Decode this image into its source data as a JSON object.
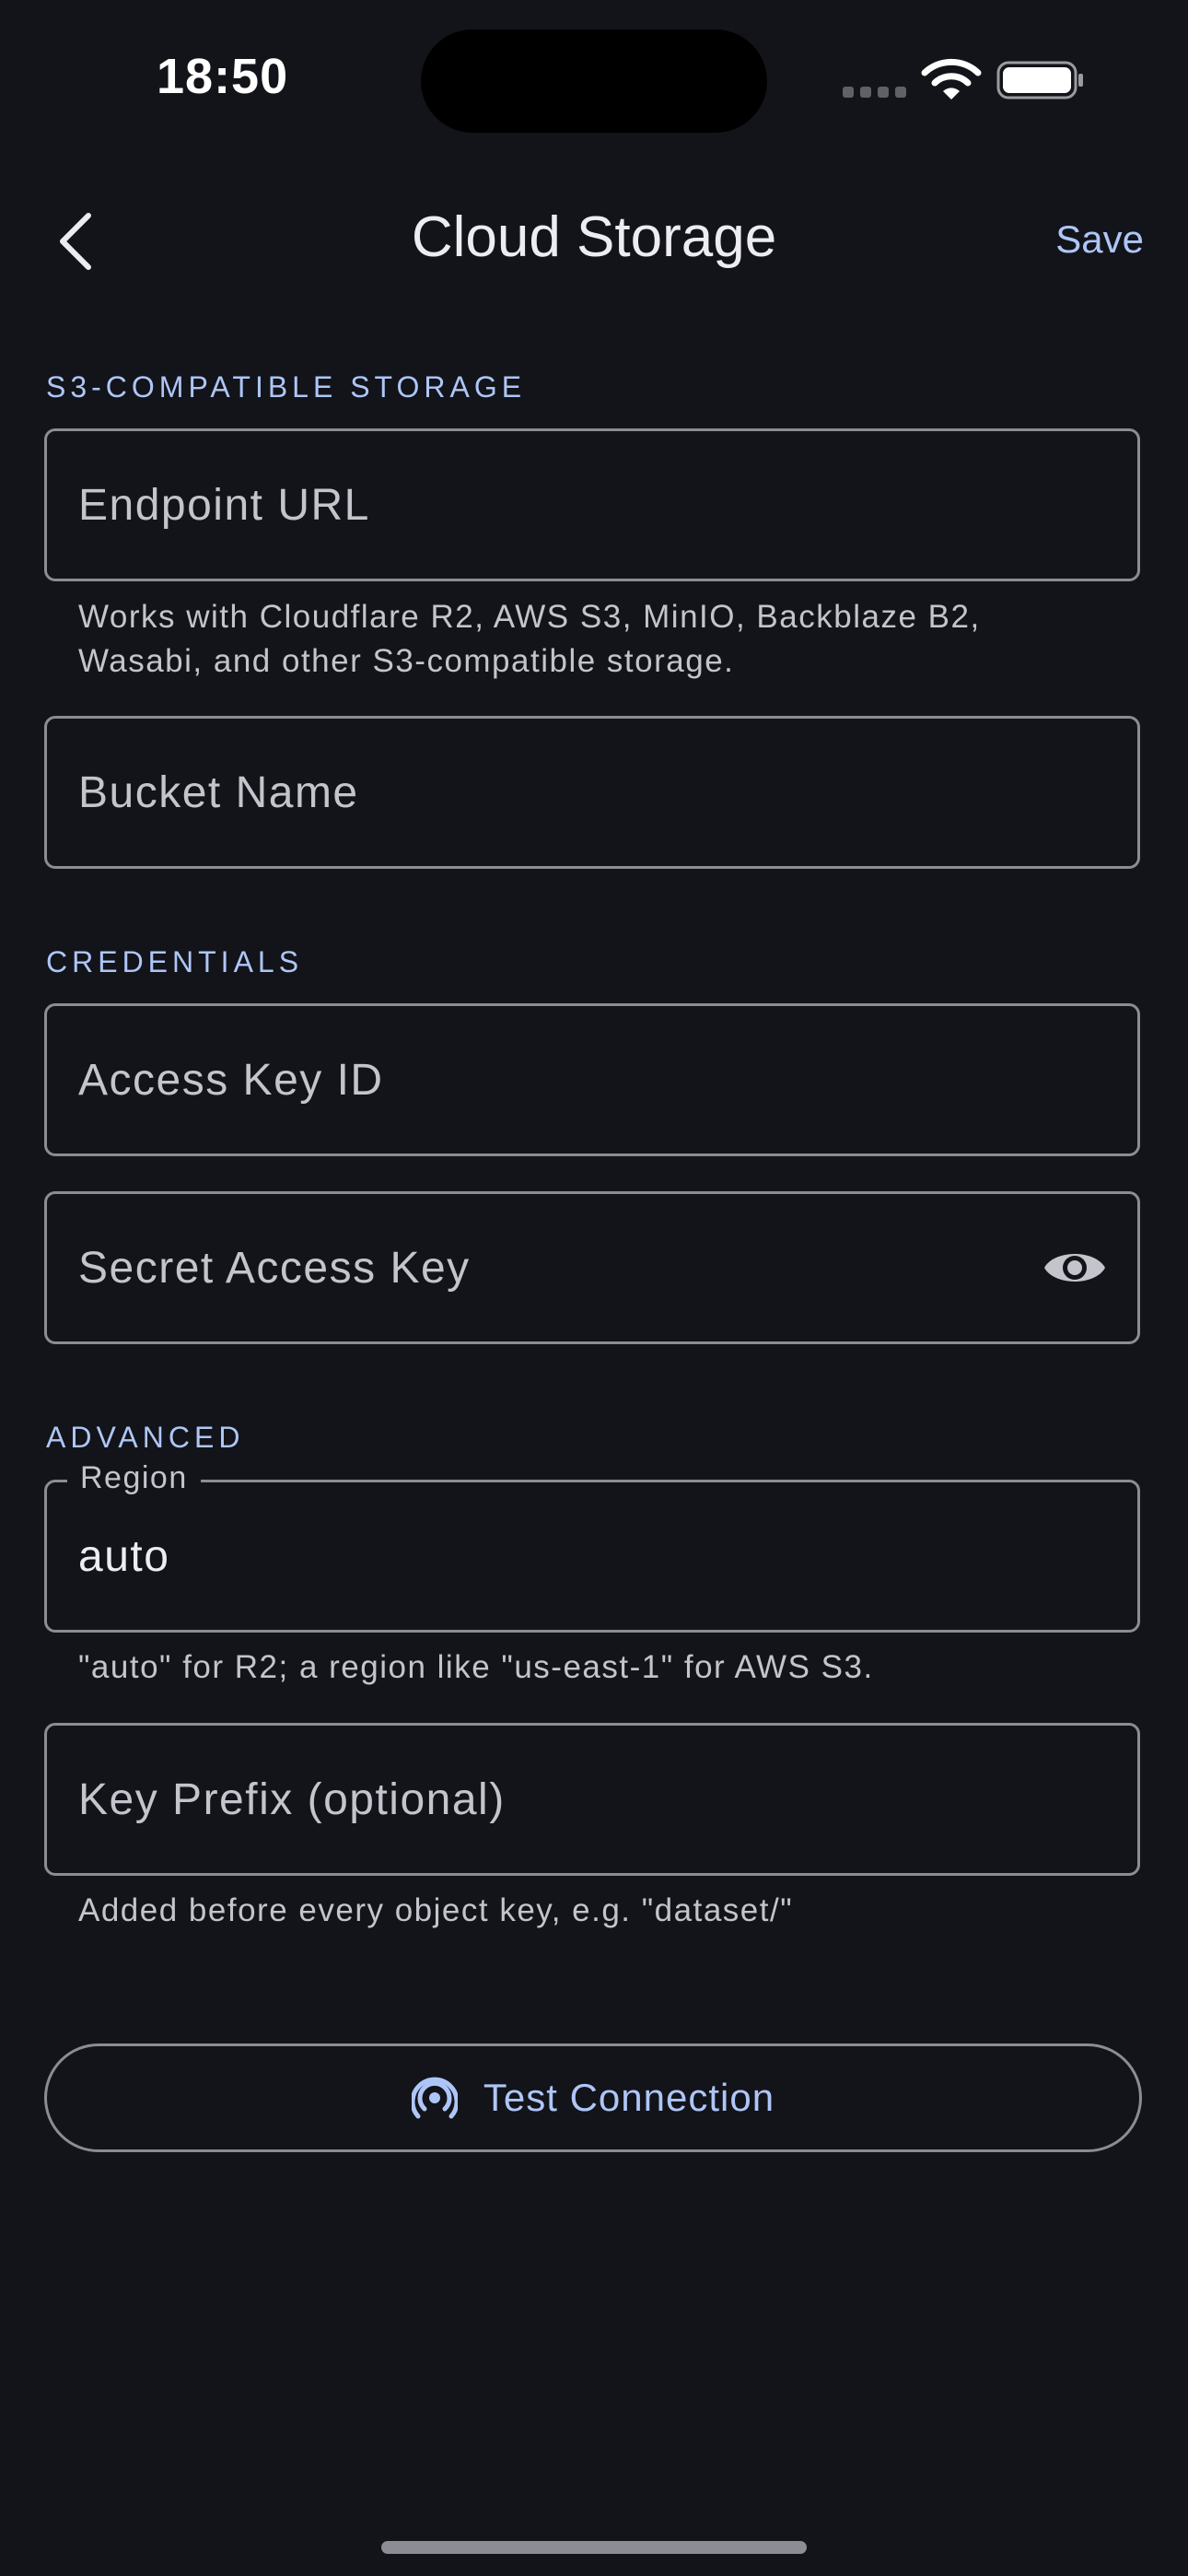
{
  "status_bar": {
    "time": "18:50"
  },
  "header": {
    "title": "Cloud Storage",
    "save_label": "Save"
  },
  "sections": {
    "storage": "S3-COMPATIBLE STORAGE",
    "credentials": "CREDENTIALS",
    "advanced": "ADVANCED"
  },
  "fields": {
    "endpoint": {
      "placeholder": "Endpoint URL",
      "value": ""
    },
    "endpoint_helper_line1": "Works with Cloudflare R2, AWS S3, MinIO, Backblaze B2,",
    "endpoint_helper_line2": "Wasabi, and other S3-compatible storage.",
    "bucket": {
      "placeholder": "Bucket Name",
      "value": ""
    },
    "access_key": {
      "placeholder": "Access Key ID",
      "value": ""
    },
    "secret_key": {
      "placeholder": "Secret Access Key",
      "value": ""
    },
    "region": {
      "label": "Region",
      "value": "auto"
    },
    "region_helper": "\"auto\" for R2; a region like \"us-east-1\" for AWS S3.",
    "prefix": {
      "placeholder": "Key Prefix (optional)",
      "value": ""
    },
    "prefix_helper": "Added before every object key, e.g. \"dataset/\""
  },
  "actions": {
    "test_connection": "Test Connection"
  },
  "icons": {
    "back": "chevron-left-icon",
    "eye": "eye-icon",
    "connection": "broadcast-icon",
    "wifi": "wifi-icon",
    "battery": "battery-icon",
    "signal": "cellular-signal-icon"
  },
  "colors": {
    "background": "#131419",
    "accent": "#aec6f7",
    "outline": "#8b8c94",
    "text_primary": "#ececf1",
    "text_secondary": "#c3c4cc"
  }
}
